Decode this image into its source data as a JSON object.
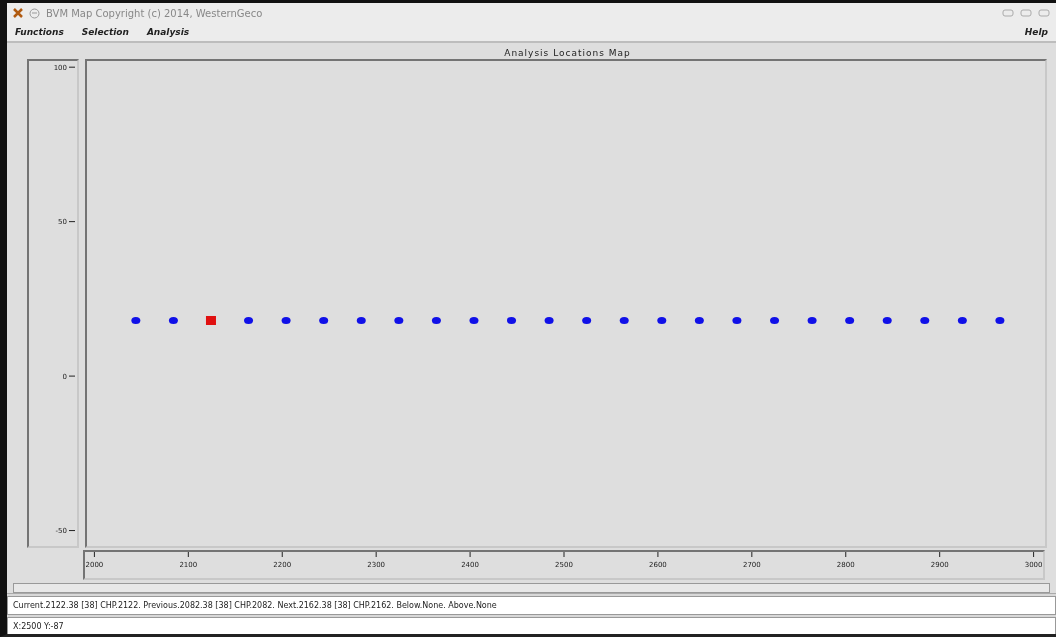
{
  "window": {
    "title": "BVM Map  Copyright (c) 2014, WesternGeco"
  },
  "menu": {
    "items": [
      {
        "label": "Functions"
      },
      {
        "label": "Selection"
      },
      {
        "label": "Analysis"
      }
    ],
    "help": "Help"
  },
  "map": {
    "title": "Analysis Locations Map",
    "chart_data": {
      "type": "scatter",
      "x": [
        2042,
        2082,
        2122,
        2162,
        2202,
        2242,
        2282,
        2322,
        2362,
        2402,
        2442,
        2482,
        2522,
        2562,
        2602,
        2642,
        2682,
        2722,
        2762,
        2802,
        2842,
        2882,
        2922,
        2962
      ],
      "series": [
        {
          "color": "#1010e8",
          "values": [
            18,
            18,
            null,
            18,
            18,
            18,
            18,
            18,
            18,
            18,
            18,
            18,
            18,
            18,
            18,
            18,
            18,
            18,
            18,
            18,
            18,
            18,
            18,
            18
          ]
        },
        {
          "color": "#e01010",
          "values": [
            null,
            null,
            18,
            null,
            null,
            null,
            null,
            null,
            null,
            null,
            null,
            null,
            null,
            null,
            null,
            null,
            null,
            null,
            null,
            null,
            null,
            null,
            null,
            null
          ]
        }
      ],
      "xlim": [
        1990,
        3010
      ],
      "ylim": [
        -55,
        102
      ],
      "xticks": [
        2000,
        2100,
        2200,
        2300,
        2400,
        2500,
        2600,
        2700,
        2800,
        2900,
        3000
      ],
      "yticks": [
        -50,
        0,
        50,
        100
      ]
    }
  },
  "status": {
    "message": "Current.2122.38 [38] CHP.2122.  Previous.2082.38 [38] CHP.2082.  Next.2162.38 [38] CHP.2162.  Below.None.  Above.None",
    "coordinates": "X:2500  Y:-87"
  }
}
